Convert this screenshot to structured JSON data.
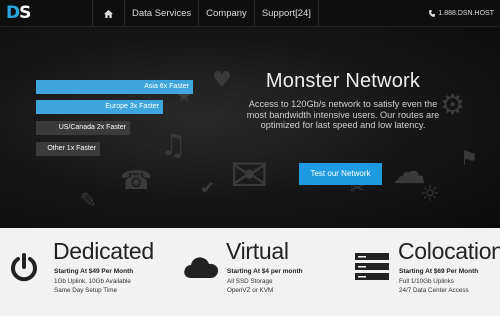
{
  "logo": {
    "text": "DS"
  },
  "nav": {
    "home_icon": "home-icon",
    "items": [
      {
        "label": "Data Services"
      },
      {
        "label": "Company"
      },
      {
        "label": "Support[24]"
      }
    ]
  },
  "phone": {
    "icon": "phone-icon",
    "number": "1.888.DSN.HOST"
  },
  "hero": {
    "bars": [
      {
        "label": "Asia 6x Faster",
        "relative_speed": 6
      },
      {
        "label": "Europe 3x Faster",
        "relative_speed": 3
      },
      {
        "label": "US/Canada 2x Faster",
        "relative_speed": 2
      },
      {
        "label": "Other 1x Faster",
        "relative_speed": 1
      }
    ],
    "title": "Monster Network",
    "text": "Access to 120Gb/s network to satisfy even the most bandwidth intensive users. Our routes are optimized for last speed and low latency.",
    "cta": "Test our Network"
  },
  "services": [
    {
      "icon": "power-icon",
      "title": "Dedicated",
      "price": "Starting At $49 Per Month",
      "lines": [
        "1Gb Uplink. 10Gb Available",
        "Same Day Setup Time"
      ]
    },
    {
      "icon": "cloud-icon",
      "title": "Virtual",
      "price": "Starting At $4 per month",
      "lines": [
        "All SSD Storage",
        "OpenVZ or KVM"
      ]
    },
    {
      "icon": "server-icon",
      "title": "Colocation",
      "price": "Starting At $69 Per Month",
      "lines": [
        "Full 1/10Gb Uplinks",
        "24/7 Data Center Access"
      ]
    }
  ],
  "colors": {
    "accent": "#1e9be0",
    "bar_blue": "#3fa6dd",
    "bar_dark": "#3b3b3b",
    "services_bg": "#f2f2f2"
  }
}
